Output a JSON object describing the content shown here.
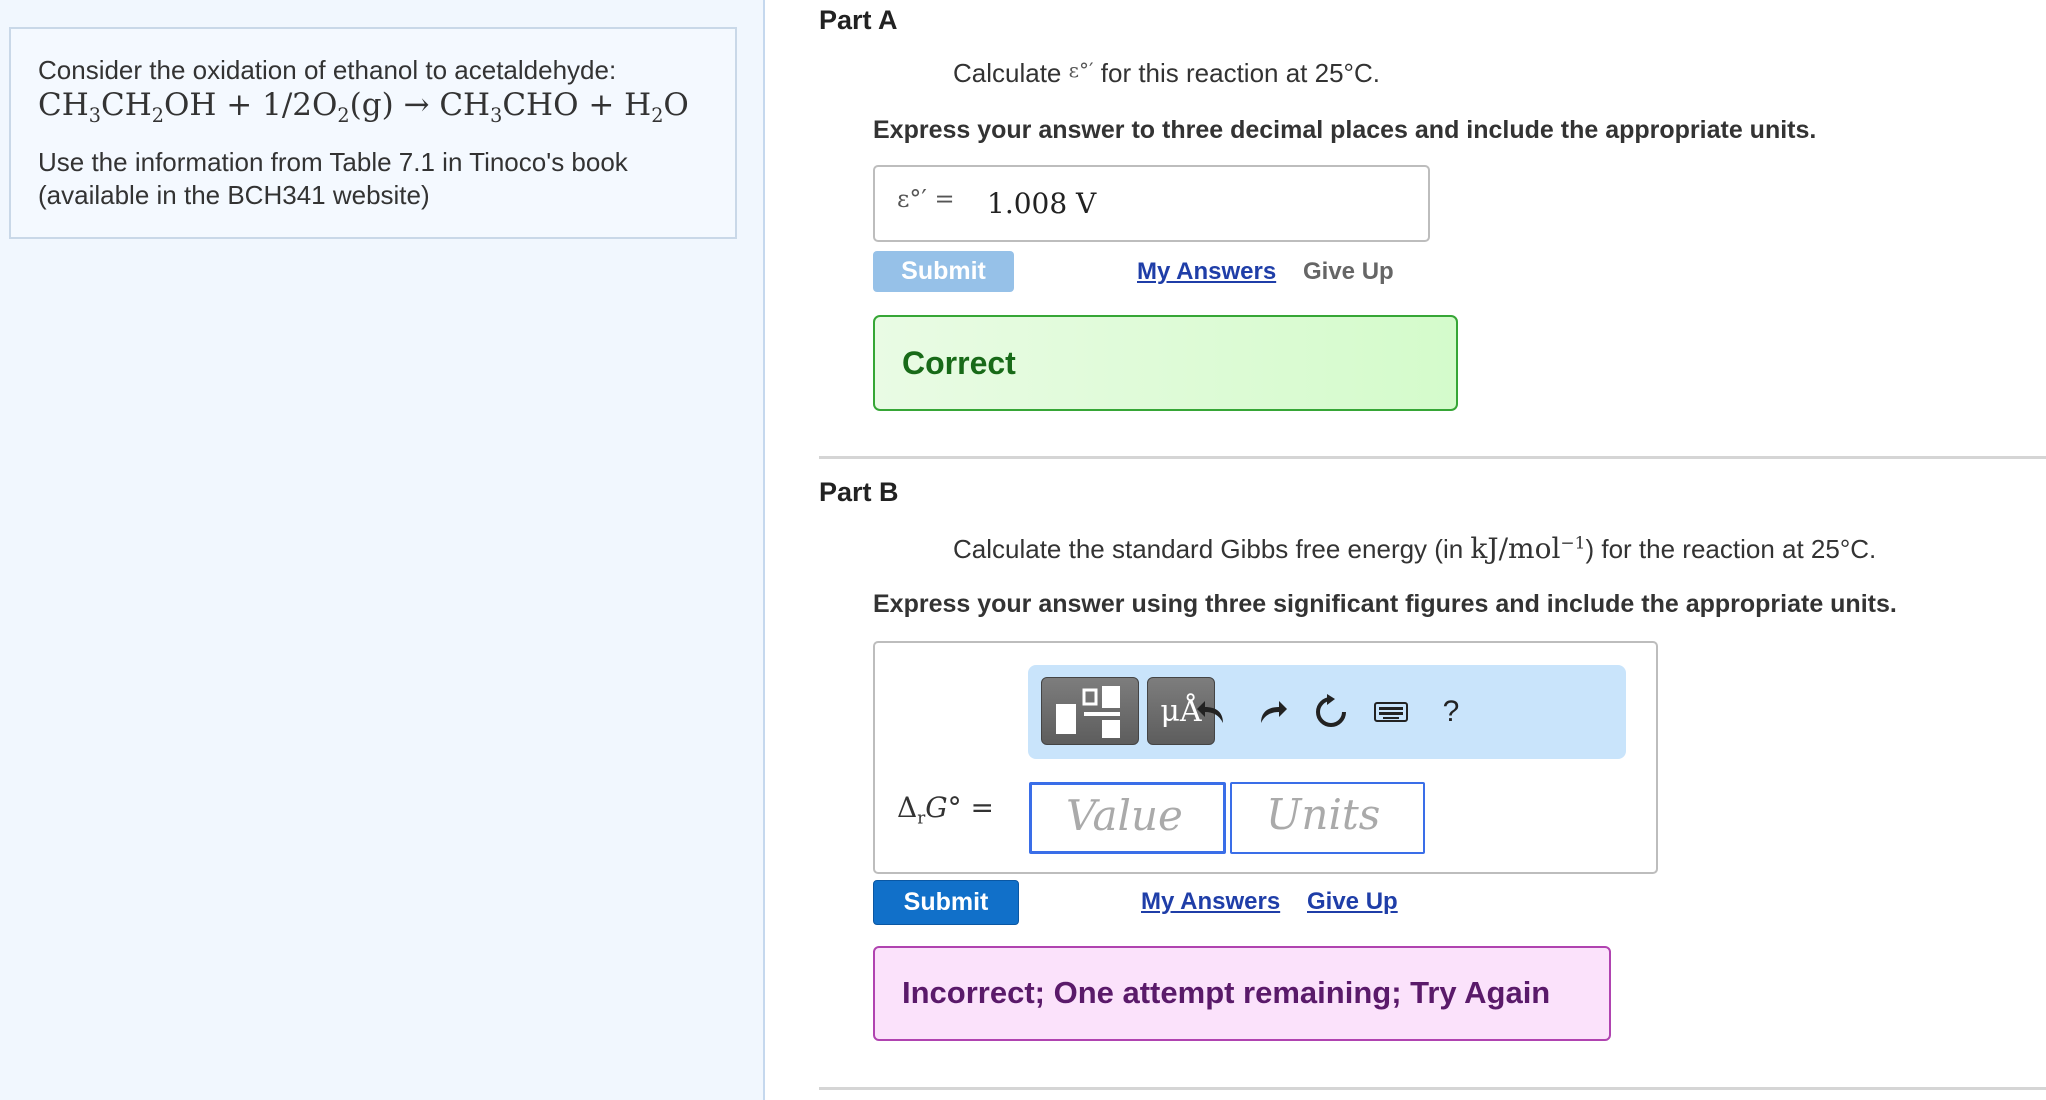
{
  "problem": {
    "intro": "Consider the oxidation of ethanol to acetaldehyde:",
    "equation": {
      "part1": "CH",
      "sub1": "3",
      "part2": "CH",
      "sub2": "2",
      "part3": "OH + 1/2O",
      "sub3": "2",
      "part4": "(g) → CH",
      "sub4": "3",
      "part5": "CHO + H",
      "sub5": "2",
      "part6": "O"
    },
    "info_line1": "Use the information from Table 7.1 in Tinoco's book",
    "info_line2": "(available in the BCH341 website)"
  },
  "part_a": {
    "title": "Part A",
    "prompt_before": "Calculate ",
    "prompt_symbol": "ε°′",
    "prompt_after": " for this reaction at 25°C.",
    "instruction": "Express your answer to three decimal places and include the appropriate units.",
    "answer_symbol": "ε°′ =",
    "answer_value": "1.008 V",
    "submit_label": "Submit",
    "my_answers_label": "My Answers",
    "give_up_label": "Give Up",
    "feedback": "Correct"
  },
  "part_b": {
    "title": "Part B",
    "prompt_before": "Calculate the standard Gibbs free energy (in ",
    "prompt_units": "kJ/mol",
    "prompt_exp": "−1",
    "prompt_after": ") for the reaction at 25°C.",
    "instruction": "Express your answer using three significant figures and include the appropriate units.",
    "label_delta": "Δ",
    "label_sub": "r",
    "label_rest": "G° =",
    "value_placeholder": "Value",
    "units_placeholder": "Units",
    "toolbar": {
      "templates_icon": "templates-icon",
      "units_label": "μÅ",
      "undo_icon": "undo-icon",
      "redo_icon": "redo-icon",
      "reset_icon": "reset-icon",
      "keyboard_icon": "keyboard-icon",
      "help_label": "?"
    },
    "submit_label": "Submit",
    "my_answers_label": "My Answers",
    "give_up_label": "Give Up",
    "feedback": "Incorrect; One attempt remaining; Try Again"
  },
  "colors": {
    "submit_active": "#1170c9",
    "submit_disabled": "#96c1e8",
    "correct_border": "#36a636",
    "incorrect_border": "#b043b0",
    "left_panel_bg": "#f1f7fe"
  }
}
